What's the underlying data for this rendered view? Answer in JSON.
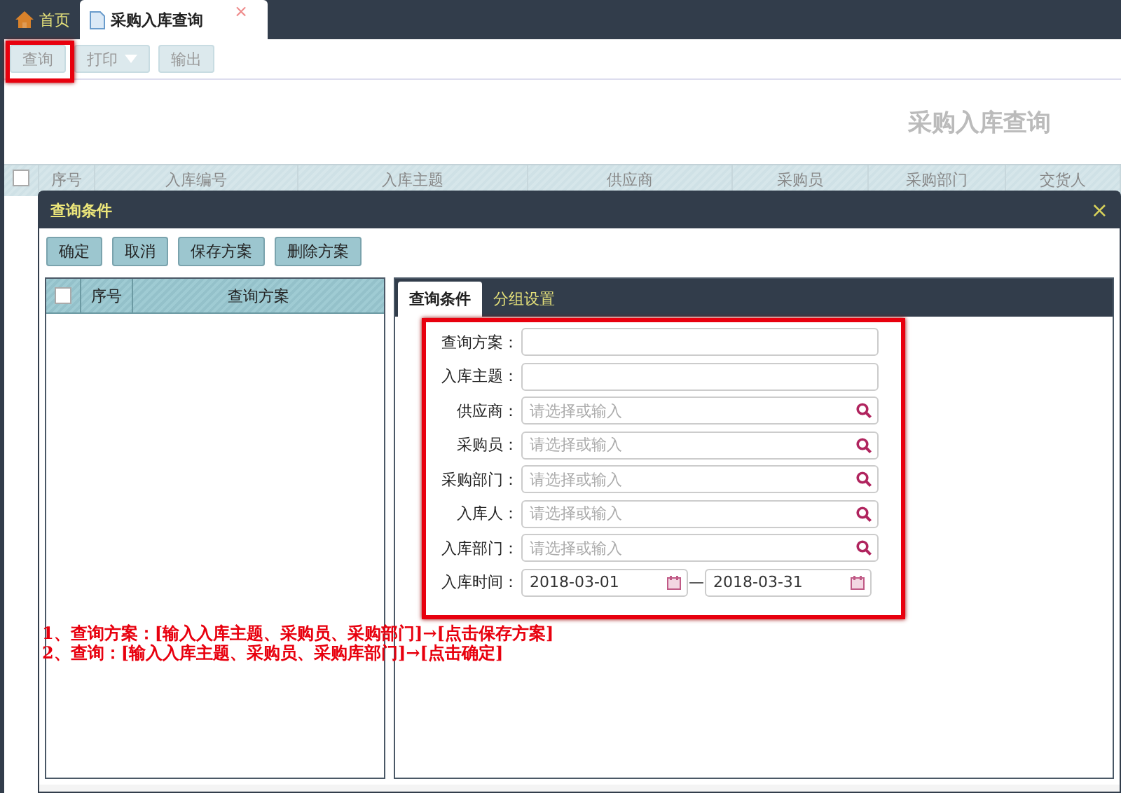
{
  "tabs": [
    {
      "label": "首页",
      "kind": "home",
      "selected": false
    },
    {
      "label": "采购入库查询",
      "kind": "page",
      "selected": true,
      "close": "×"
    }
  ],
  "toolbar": [
    {
      "label": "查询",
      "dropdown": false
    },
    {
      "label": "打印",
      "dropdown": true
    },
    {
      "label": "输出",
      "dropdown": false
    }
  ],
  "page_title": "采购入库查询",
  "table": {
    "select_all_checked": false,
    "columns": [
      "序号",
      "入库编号",
      "入库主题",
      "供应商",
      "采购员",
      "采购部门",
      "交货人"
    ]
  },
  "dialog": {
    "title": "查询条件",
    "close": "×",
    "buttons": [
      "确定",
      "取消",
      "保存方案",
      "删除方案"
    ],
    "scheme_table": {
      "select_all_checked": false,
      "columns": [
        "序号",
        "查询方案"
      ]
    },
    "tabs": [
      {
        "label": "查询条件",
        "selected": true
      },
      {
        "label": "分组设置",
        "selected": false
      }
    ],
    "fields": [
      {
        "label": "查询方案：",
        "kind": "text"
      },
      {
        "label": "入库主题：",
        "kind": "text"
      },
      {
        "label": "供应商：",
        "kind": "lookup",
        "placeholder": "请选择或输入"
      },
      {
        "label": "采购员：",
        "kind": "lookup",
        "placeholder": "请选择或输入"
      },
      {
        "label": "采购部门：",
        "kind": "lookup",
        "placeholder": "请选择或输入"
      },
      {
        "label": "入库人：",
        "kind": "lookup",
        "placeholder": "请选择或输入"
      },
      {
        "label": "入库部门：",
        "kind": "lookup",
        "placeholder": "请选择或输入"
      },
      {
        "label": "入库时间：",
        "kind": "daterange",
        "from": "2018-03-01",
        "separator": "—",
        "to": "2018-03-31"
      }
    ]
  },
  "notes": [
    "1、查询方案：[输入入库主题、采购员、采购部门]→[点击保存方案]",
    "2、查询：[输入入库主题、采购员、采购库部门]→[点击确定]"
  ]
}
